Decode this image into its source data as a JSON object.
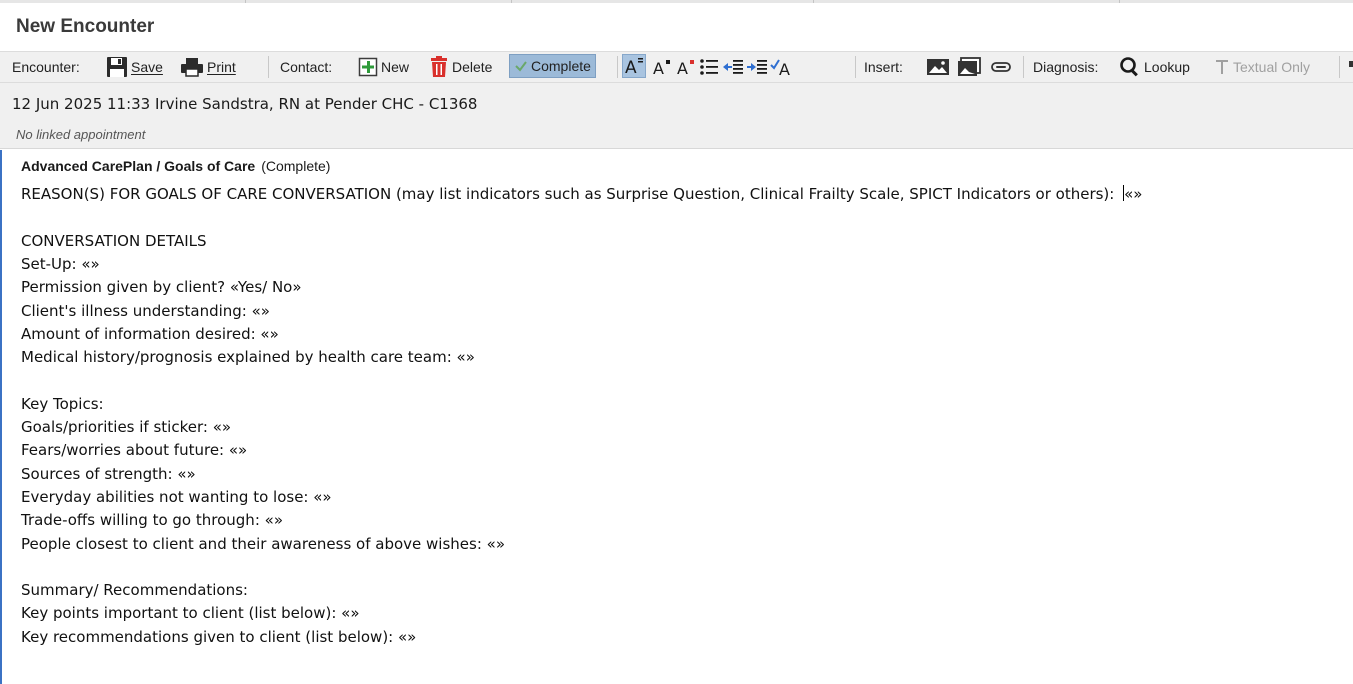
{
  "window": {
    "title": "New Encounter"
  },
  "toolbar": {
    "encounter_label": "Encounter:",
    "save_label": "Save",
    "print_label": "Print",
    "contact_label": "Contact:",
    "new_label": "New",
    "delete_label": "Delete",
    "complete_label": "Complete",
    "insert_label": "Insert:",
    "diagnosis_label": "Diagnosis:",
    "lookup_label": "Lookup",
    "textual_only_label": "Textual Only",
    "icons": [
      "save-icon",
      "print-icon",
      "add-icon",
      "trash-icon",
      "check-icon",
      "font-size-icon",
      "superscript-icon",
      "subscript-icon",
      "bullet-list-icon",
      "outdent-icon",
      "indent-icon",
      "spellcheck-icon",
      "image-icon",
      "gallery-icon",
      "attachment-icon",
      "search-icon",
      "text-icon"
    ],
    "colors": {
      "toolbar_bg": "#f0f0f0",
      "complete_bg": "#9cbad8",
      "delete_icon": "#d9302c",
      "add_icon": "#2e9a3a"
    }
  },
  "encounter": {
    "info": "12 Jun 2025 11:33 Irvine Sandstra, RN at Pender CHC - C1368",
    "appointment": "No linked appointment"
  },
  "note": {
    "title": "Advanced CarePlan / Goals of Care",
    "status": "(Complete)",
    "lines": [
      "REASON(S) FOR GOALS OF CARE CONVERSATION (may list indicators such as Surprise Question, Clinical Frailty Scale, SPICT Indicators or others): «»",
      "",
      "CONVERSATION DETAILS",
      "Set-Up: «»",
      "Permission given by client? «Yes/ No»",
      "Client's illness understanding: «»",
      "Amount of information desired: «»",
      "Medical history/prognosis explained by health care team: «»",
      "",
      "Key Topics:",
      "Goals/priorities if sticker: «»",
      "Fears/worries about future: «»",
      "Sources of strength: «»",
      "Everyday abilities not wanting to lose: «»",
      "Trade-offs willing to go through: «»",
      "People closest to client and their awareness of above wishes: «»",
      "",
      "Summary/ Recommendations:",
      "Key points important to client (list below): «»",
      "Key recommendations given to client (list below): «»"
    ]
  }
}
